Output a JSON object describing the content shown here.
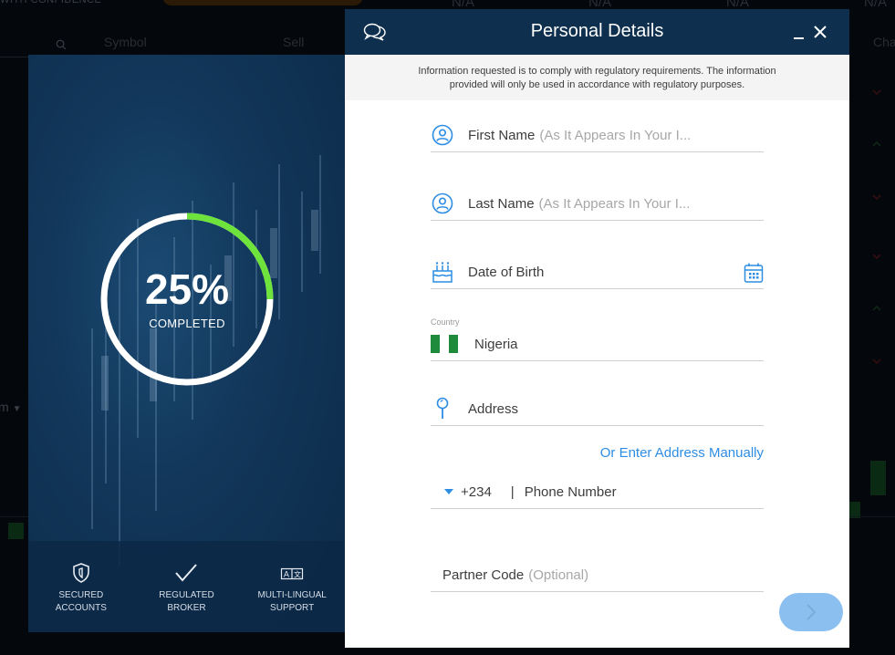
{
  "background": {
    "tagline": "WITH CONFIDENCE",
    "na_values": [
      "N/A",
      "N/A",
      "N/A",
      "N/A"
    ],
    "columns": [
      "Symbol",
      "Sell",
      "Cha"
    ],
    "sort_label": "m"
  },
  "promo": {
    "progress_percent": 25,
    "progress_text": "25%",
    "progress_label": "COMPLETED",
    "progress_color": "#6ee33b",
    "features": [
      {
        "icon": "shield-icon",
        "line1": "SECURED",
        "line2": "ACCOUNTS"
      },
      {
        "icon": "checkmark-icon",
        "line1": "REGULATED",
        "line2": "BROKER"
      },
      {
        "icon": "translate-icon",
        "line1": "MULTI-LINGUAL",
        "line2": "SUPPORT"
      }
    ]
  },
  "dialog": {
    "title": "Personal Details",
    "notice_line1": "Information requested is to comply with regulatory requirements. The information",
    "notice_line2": "provided will only be used in accordance with regulatory purposes.",
    "first_name": {
      "label": "First Name",
      "hint": "(As It Appears In Your I..."
    },
    "last_name": {
      "label": "Last Name",
      "hint": "(As It Appears In Your I..."
    },
    "dob": {
      "label": "Date of Birth"
    },
    "country": {
      "small_label": "Country",
      "value": "Nigeria"
    },
    "address": {
      "label": "Address"
    },
    "manual_link": "Or Enter Address Manually",
    "phone": {
      "code": "+234",
      "separator": "|",
      "placeholder": "Phone Number"
    },
    "partner": {
      "label": "Partner Code",
      "hint": "(Optional)"
    },
    "accent_color": "#2d8de3",
    "header_color": "#0e2f4d"
  }
}
